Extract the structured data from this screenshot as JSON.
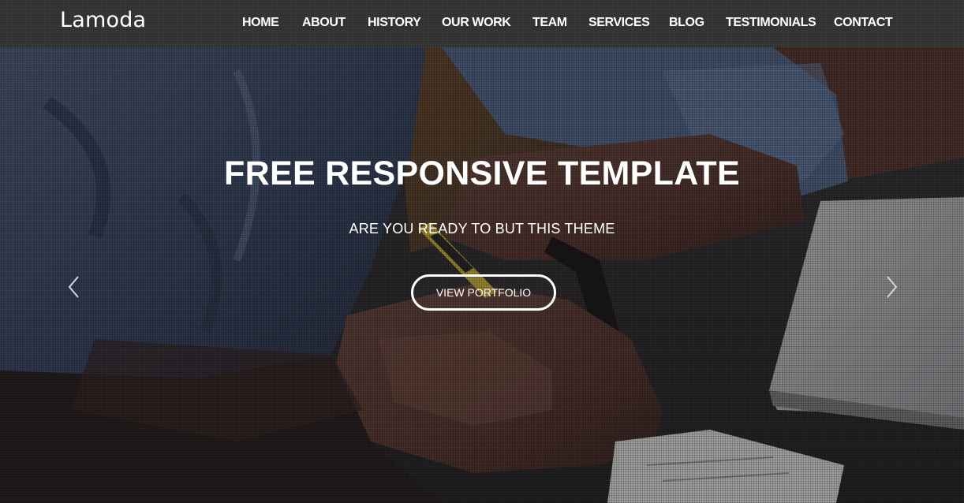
{
  "brand": {
    "name": "Lamoda"
  },
  "nav": {
    "items": [
      {
        "label": "HOME"
      },
      {
        "label": "ABOUT"
      },
      {
        "label": "HISTORY"
      },
      {
        "label": "OUR WORK"
      },
      {
        "label": "TEAM"
      },
      {
        "label": "SERVICES"
      },
      {
        "label": "BLOG"
      },
      {
        "label": "TESTIMONIALS"
      },
      {
        "label": "CONTACT"
      }
    ]
  },
  "hero": {
    "title": "FREE RESPONSIVE TEMPLATE",
    "subtitle": "ARE YOU READY TO BUT THIS THEME",
    "cta_label": "VIEW PORTFOLIO",
    "prev_icon": "chevron-left-icon",
    "next_icon": "chevron-right-icon"
  },
  "colors": {
    "navbar_bg": "#3a3a3a",
    "text": "#ffffff",
    "cta_border": "#ffffff"
  }
}
